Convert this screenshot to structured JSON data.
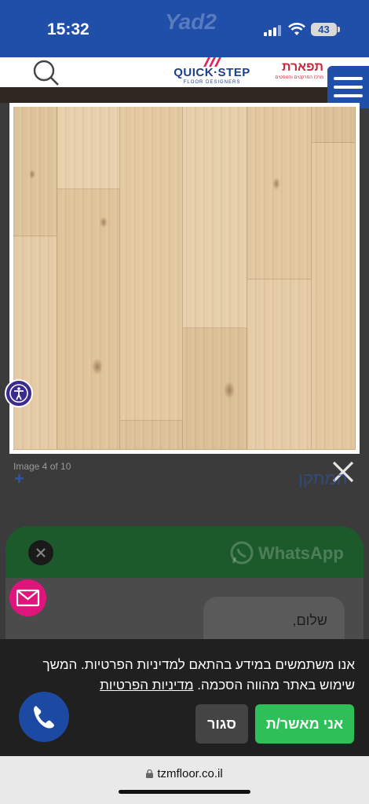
{
  "status_bar": {
    "time": "15:32",
    "watermark": "Yad2",
    "battery": "43"
  },
  "header": {
    "quickstep_name": "QUICK·STEP",
    "quickstep_sub": "FLOOR DESIGNERS",
    "tiferet_name": "תפארת",
    "tiferet_sub": "מרכז הפרקטים והטפטים"
  },
  "lightbox": {
    "caption": "Image 4 of 10"
  },
  "page": {
    "plus": "+",
    "heading": "המתקן"
  },
  "whatsapp": {
    "title": "WhatsApp",
    "greeting": "שלום,"
  },
  "cookie_banner": {
    "text": "אנו משתמשים במידע בהתאם למדיניות הפרטיות. המשך שימוש באתר מהווה הסכמה.",
    "link": "מדיניות הפרטיות",
    "accept_label": "אני מאשר/ת",
    "close_label": "סגור"
  },
  "browser": {
    "url": "tzmfloor.co.il"
  },
  "colors": {
    "brand_blue": "#1f4fa8",
    "accept_green": "#2fbf58",
    "mail_pink": "#e0157c",
    "a11y_purple": "#3b2a8f"
  }
}
